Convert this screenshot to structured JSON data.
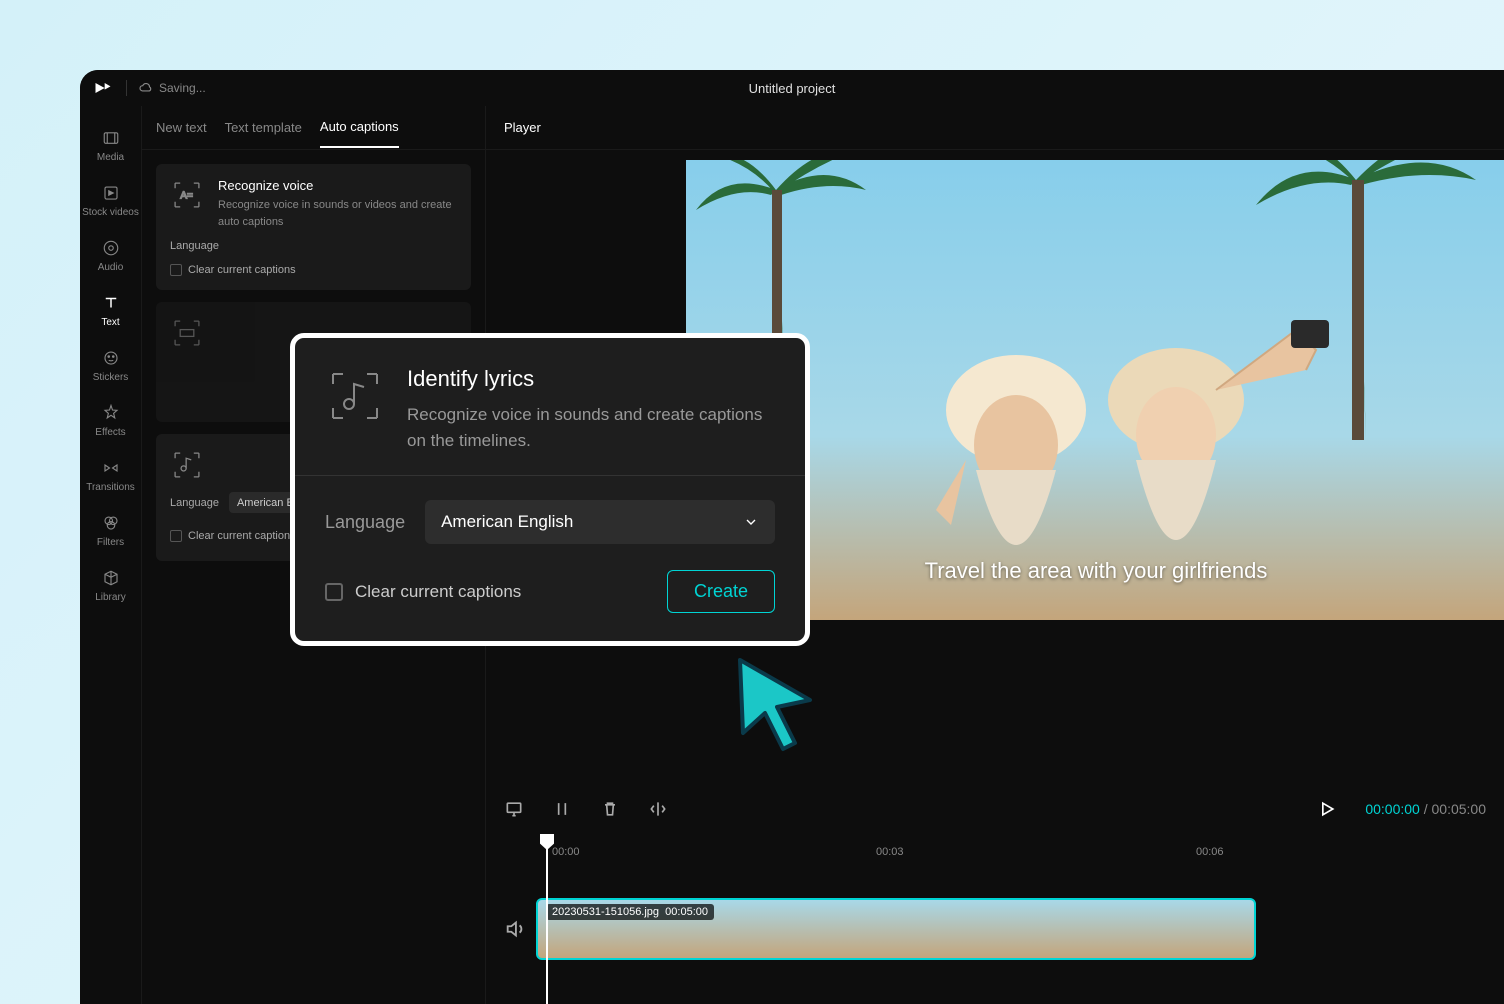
{
  "titlebar": {
    "saving_label": "Saving...",
    "project_title": "Untitled project"
  },
  "rail": {
    "items": [
      {
        "label": "Media"
      },
      {
        "label": "Stock videos"
      },
      {
        "label": "Audio"
      },
      {
        "label": "Text"
      },
      {
        "label": "Stickers"
      },
      {
        "label": "Effects"
      },
      {
        "label": "Transitions"
      },
      {
        "label": "Filters"
      },
      {
        "label": "Library"
      }
    ]
  },
  "panel": {
    "tabs": [
      {
        "label": "New text"
      },
      {
        "label": "Text template"
      },
      {
        "label": "Auto captions"
      }
    ],
    "card1": {
      "title": "Recognize voice",
      "desc": "Recognize voice in sounds or videos and create auto captions",
      "lang_label": "Language",
      "clear_label": "Clear current captions"
    },
    "card3": {
      "lang_label": "Language",
      "lang_value": "American English",
      "clear_label": "Clear current captions",
      "create_label": "Create"
    }
  },
  "player": {
    "header_label": "Player",
    "caption_text": "Travel the area with your girlfriends",
    "timecode_current": "00:00:00",
    "timecode_total": "00:05:00"
  },
  "timeline": {
    "marks": [
      "00:00",
      "00:03",
      "00:06"
    ],
    "clip_name": "20230531-151056.jpg",
    "clip_duration": "00:05:00"
  },
  "popup": {
    "title": "Identify lyrics",
    "desc": "Recognize voice in sounds and create captions on the timelines.",
    "lang_label": "Language",
    "lang_value": "American English",
    "clear_label": "Clear current captions",
    "create_label": "Create"
  }
}
